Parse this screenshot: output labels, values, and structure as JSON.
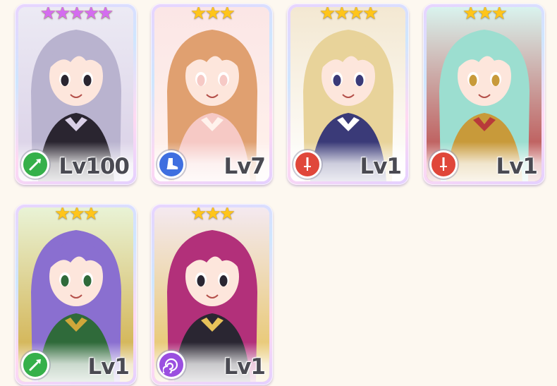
{
  "colors": {
    "star_gold": "#ffc51a",
    "star_purple": "#d46cf0",
    "class_green": "#35b04a",
    "class_blue": "#3f6fe0",
    "class_red": "#e0473a",
    "class_purple": "#9a4fe0"
  },
  "cards": [
    {
      "stars": 5,
      "star_color": "purple",
      "class_icon": "spear-icon",
      "class_color": "green",
      "level": "Lv100",
      "palette": [
        "#eceaf4",
        "#b9b3cf",
        "#2a2530",
        "#d9cfe6"
      ]
    },
    {
      "stars": 3,
      "star_color": "gold",
      "class_icon": "boot-icon",
      "class_color": "blue",
      "level": "Lv7",
      "palette": [
        "#fbe6e6",
        "#e0a070",
        "#f6c9c5",
        "#fff2ec"
      ]
    },
    {
      "stars": 4,
      "star_color": "gold",
      "class_icon": "sword-icon",
      "class_color": "red",
      "level": "Lv1",
      "palette": [
        "#f3e8d2",
        "#e8d39a",
        "#3a3a78",
        "#ffffff"
      ]
    },
    {
      "stars": 3,
      "star_color": "gold",
      "class_icon": "sword-icon",
      "class_color": "red",
      "level": "Lv1",
      "palette": [
        "#d9f3ee",
        "#9cded0",
        "#c89a3a",
        "#b83a3a"
      ]
    },
    {
      "stars": 3,
      "star_color": "gold",
      "class_icon": "spear-icon",
      "class_color": "green",
      "level": "Lv1",
      "palette": [
        "#e9f3d6",
        "#8a6fd0",
        "#2f6a3a",
        "#cfa73a"
      ]
    },
    {
      "stars": 3,
      "star_color": "gold",
      "class_icon": "vortex-icon",
      "class_color": "purple",
      "level": "Lv1",
      "palette": [
        "#f4e9f0",
        "#b2307a",
        "#2a2632",
        "#e6c25a"
      ]
    }
  ]
}
